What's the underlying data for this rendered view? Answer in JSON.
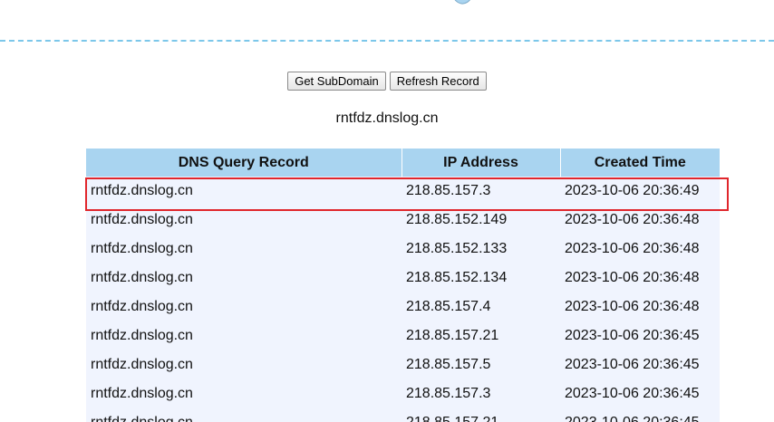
{
  "toolbar": {
    "get_subdomain_label": "Get SubDomain",
    "refresh_record_label": "Refresh Record"
  },
  "subdomain": "rntfdz.dnslog.cn",
  "table": {
    "headers": [
      "DNS Query Record",
      "IP Address",
      "Created Time"
    ],
    "rows": [
      [
        "rntfdz.dnslog.cn",
        "218.85.157.3",
        "2023-10-06 20:36:49"
      ],
      [
        "rntfdz.dnslog.cn",
        "218.85.152.149",
        "2023-10-06 20:36:48"
      ],
      [
        "rntfdz.dnslog.cn",
        "218.85.152.133",
        "2023-10-06 20:36:48"
      ],
      [
        "rntfdz.dnslog.cn",
        "218.85.152.134",
        "2023-10-06 20:36:48"
      ],
      [
        "rntfdz.dnslog.cn",
        "218.85.157.4",
        "2023-10-06 20:36:48"
      ],
      [
        "rntfdz.dnslog.cn",
        "218.85.157.21",
        "2023-10-06 20:36:45"
      ],
      [
        "rntfdz.dnslog.cn",
        "218.85.157.5",
        "2023-10-06 20:36:45"
      ],
      [
        "rntfdz.dnslog.cn",
        "218.85.157.3",
        "2023-10-06 20:36:45"
      ],
      [
        "rntfdz.dnslog.cn",
        "218.85.157.21",
        "2023-10-06 20:36:45"
      ]
    ]
  },
  "colors": {
    "header_bg": "#a9d4f0",
    "row_bg": "#f0f4fe",
    "divider": "#7cc7ea",
    "highlight": "#e0262c"
  }
}
